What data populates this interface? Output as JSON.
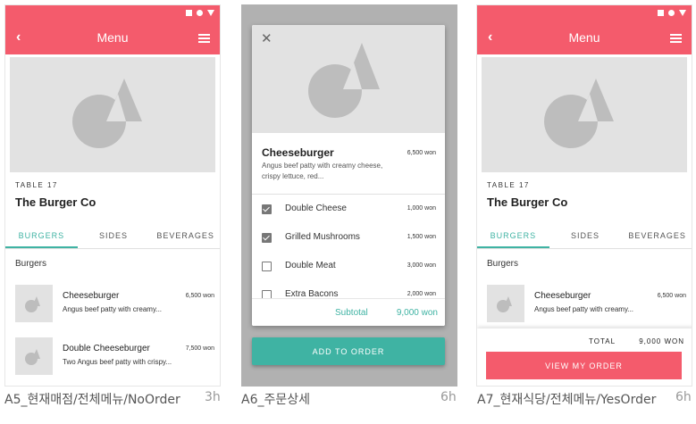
{
  "colors": {
    "brand": "#f45b6c",
    "accent": "#3fb3a3",
    "placeholder": "#e2e2e2"
  },
  "screen_a5": {
    "title": "Menu",
    "table": "TABLE 17",
    "store": "The Burger Co",
    "tabs": [
      "BURGERS",
      "SIDES",
      "BEVERAGES"
    ],
    "section": "Burgers",
    "items": [
      {
        "name": "Cheeseburger",
        "price": "6,500 won",
        "desc": "Angus beef patty with creamy..."
      },
      {
        "name": "Double Cheeseburger",
        "price": "7,500 won",
        "desc": "Two Angus beef patty with crispy..."
      }
    ],
    "caption": "A5_현재매점/전체메뉴/NoOrder",
    "time": "3h"
  },
  "screen_a6": {
    "name": "Cheeseburger",
    "price": "6,500 won",
    "desc": "Angus beef patty with creamy cheese, crispy lettuce, red...",
    "options": [
      {
        "label": "Double Cheese",
        "price": "1,000 won",
        "checked": true
      },
      {
        "label": "Grilled Mushrooms",
        "price": "1,500 won",
        "checked": true
      },
      {
        "label": "Double Meat",
        "price": "3,000 won",
        "checked": false
      },
      {
        "label": "Extra Bacons",
        "price": "2,000 won",
        "checked": false
      }
    ],
    "subtotal_label": "Subtotal",
    "subtotal_value": "9,000 won",
    "add_label": "ADD TO ORDER",
    "caption": "A6_주문상세",
    "time": "6h"
  },
  "screen_a7": {
    "title": "Menu",
    "table": "TABLE 17",
    "store": "The Burger Co",
    "tabs": [
      "BURGERS",
      "SIDES",
      "BEVERAGES"
    ],
    "section": "Burgers",
    "items": [
      {
        "name": "Cheeseburger",
        "price": "6,500 won",
        "desc": "Angus beef patty with creamy..."
      }
    ],
    "total_label": "TOTAL",
    "total_value": "9,000 WON",
    "view_label": "VIEW MY ORDER",
    "caption": "A7_현재식당/전체메뉴/YesOrder",
    "time": "6h"
  }
}
